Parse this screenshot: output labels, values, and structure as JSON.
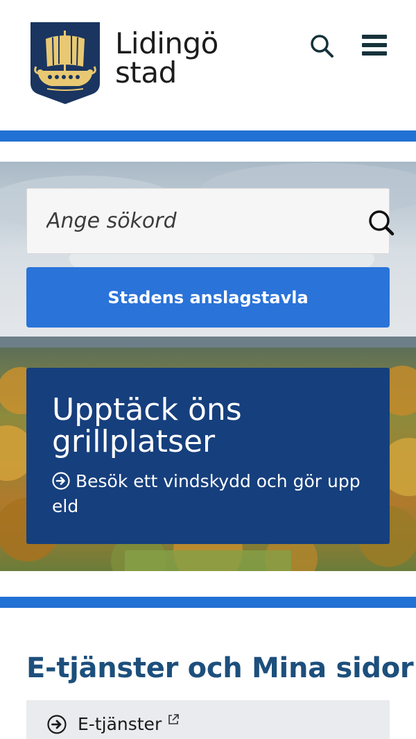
{
  "header": {
    "logo_line1": "Lidingö",
    "logo_line2": "stad",
    "search_icon": "search-icon",
    "menu_icon": "hamburger-menu-icon"
  },
  "search": {
    "placeholder": "Ange sökord",
    "button_icon": "search-icon"
  },
  "notice_board_button": "Stadens anslagstavla",
  "feature": {
    "title": "Upptäck öns grillplatser",
    "link_text": "Besök ett vindskydd och gör upp eld",
    "link_icon": "arrow-circle-right-icon"
  },
  "eservices": {
    "heading": "E-tjänster och Mina sidor",
    "items": [
      {
        "label": "E-tjänster",
        "icon": "arrow-circle-right-icon",
        "external": true
      }
    ]
  },
  "colors": {
    "accent_blue": "#2271d4",
    "button_blue": "#2a73d9",
    "feature_navy": "#163f7d",
    "heading_blue": "#1d4f7c",
    "shield_navy": "#1a3560",
    "shield_gold": "#e8c872"
  }
}
